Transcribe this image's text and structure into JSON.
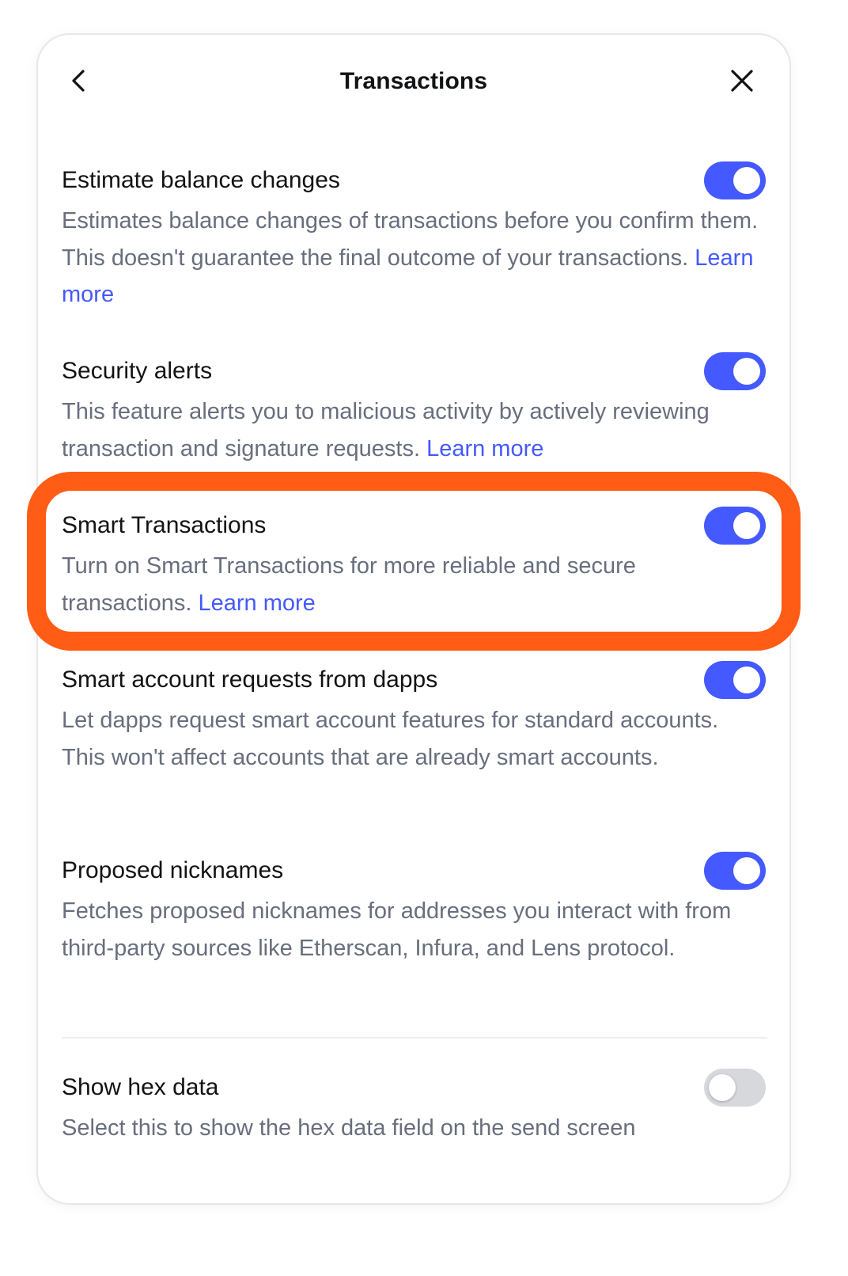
{
  "header": {
    "title": "Transactions",
    "back_icon": "chevron-left-icon",
    "close_icon": "close-icon"
  },
  "settings": [
    {
      "title": "Estimate balance changes",
      "description": "Estimates balance changes of transactions before you confirm them. This doesn't guarantee the final outcome of your transactions.",
      "link": "Learn more",
      "enabled": true
    },
    {
      "title": "Security alerts",
      "description": "This feature alerts you to malicious activity by actively reviewing transaction and signature requests.",
      "link": "Learn more",
      "enabled": true
    },
    {
      "title": "Smart Transactions",
      "description": "Turn on Smart Transactions for more reliable and secure transactions.",
      "link": "Learn more",
      "enabled": true
    },
    {
      "title": "Smart account requests from dapps",
      "description": "Let dapps request smart account features for standard accounts. This won't affect accounts that are already smart accounts.",
      "enabled": true
    },
    {
      "title": "Proposed nicknames",
      "description": "Fetches proposed nicknames for addresses you interact with from third-party sources like Etherscan, Infura, and Lens protocol.",
      "enabled": true
    },
    {
      "title": "Show hex data",
      "description": "Select this to show the hex data field on the send screen",
      "enabled": false
    }
  ],
  "colors": {
    "accent": "#4459ff",
    "highlight": "#ff5c16",
    "text_primary": "#121314",
    "text_secondary": "#686e7d",
    "toggle_off": "#d6d8dc"
  }
}
